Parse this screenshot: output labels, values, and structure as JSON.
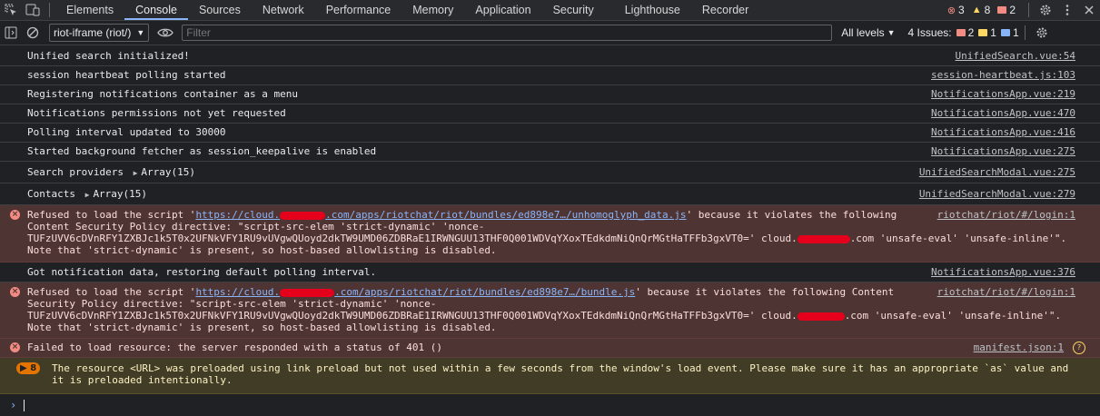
{
  "tabs": [
    "Elements",
    "Console",
    "Sources",
    "Network",
    "Performance",
    "Memory",
    "Application",
    "Security",
    "Lighthouse",
    "Recorder"
  ],
  "counts": {
    "errors": "3",
    "warnings": "8",
    "messages": "2"
  },
  "toolbar": {
    "context": "riot-iframe (riot/)",
    "filter_placeholder": "Filter",
    "levels": "All levels",
    "issues_label": "4 Issues:",
    "issues_errors": "2",
    "issues_warnings": "1",
    "issues_info": "1"
  },
  "messages": [
    {
      "text": "Unified search initialized!",
      "source": "UnifiedSearch.vue:54"
    },
    {
      "text": "session heartbeat polling started",
      "source": "session-heartbeat.js:103"
    },
    {
      "text": "Registering notifications container as a menu",
      "source": "NotificationsApp.vue:219"
    },
    {
      "text": "Notifications permissions not yet requested",
      "source": "NotificationsApp.vue:470"
    },
    {
      "text": "Polling interval updated to 30000",
      "source": "NotificationsApp.vue:416"
    },
    {
      "text": "Started background fetcher as session_keepalive is enabled",
      "source": "NotificationsApp.vue:275"
    },
    {
      "text": "Search providers",
      "array": "Array(15)",
      "source": "UnifiedSearchModal.vue:275"
    },
    {
      "text": "Contacts",
      "array": "Array(15)",
      "source": "UnifiedSearchModal.vue:279"
    }
  ],
  "error1": {
    "pre": "Refused to load the script '",
    "url_a": "https://cloud.",
    "url_b": ".com/apps/riotchat/riot/bundles/ed898e7…/unhomoglyph_data.js",
    "post": "' because it violates the following",
    "line2": "Content Security Policy directive: \"script-src-elem 'strict-dynamic' 'nonce-",
    "line3a": "TUFzUVV6cDVnRFY1ZXBJc1k5T0x2UFNkVFY1RU9vUVgwQUoyd2dkTW9UMD06ZDBRaE1IRWNGUU13THF0Q001WDVqYXoxTEdkdmNiQnQrMGtHaTFFb3gxVT0=' cloud.",
    "line3b": ".com 'unsafe-eval' 'unsafe-inline'\".",
    "line4": "Note that 'strict-dynamic' is present, so host-based allowlisting is disabled.",
    "source": "riotchat/riot/#/login:1"
  },
  "msg_after": {
    "text": "Got notification data, restoring default polling interval.",
    "source": "NotificationsApp.vue:376"
  },
  "error2": {
    "pre": "Refused to load the script '",
    "url_a": "https://cloud.",
    "url_b": ".com/apps/riotchat/riot/bundles/ed898e7…/bundle.js",
    "post": "' because it violates the following Content",
    "line2": "Security Policy directive: \"script-src-elem 'strict-dynamic' 'nonce-",
    "line3a": "TUFzUVV6cDVnRFY1ZXBJc1k5T0x2UFNkVFY1RU9vUVgwQUoyd2dkTW9UMD06ZDBRaE1IRWNGUU13THF0Q001WDVqYXoxTEdkdmNiQnQrMGtHaTFFb3gxVT0=' cloud.",
    "line3b": ".com 'unsafe-eval' 'unsafe-inline'\".",
    "line4": "Note that 'strict-dynamic' is present, so host-based allowlisting is disabled.",
    "source": "riotchat/riot/#/login:1"
  },
  "error3": {
    "text": "Failed to load resource: the server responded with a status of 401 ()",
    "source": "manifest.json:1"
  },
  "warning": {
    "count": "8",
    "line1": "The resource <URL> was preloaded using link preload but not used within a few seconds from the window's load event. Please make sure it has an appropriate `as` value and",
    "line2": "it is preloaded intentionally."
  },
  "colors": {
    "background": "#202124",
    "accent": "#8ab4f8",
    "error_bg": "#4e3534",
    "warning_bg": "#413c26",
    "redaction": "#e5001c"
  }
}
